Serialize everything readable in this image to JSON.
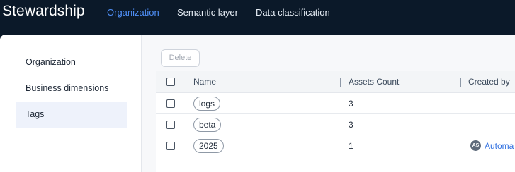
{
  "app": {
    "title": "Stewardship"
  },
  "nav": {
    "tabs": [
      {
        "label": "Organization",
        "active": true
      },
      {
        "label": "Semantic layer",
        "active": false
      },
      {
        "label": "Data classification",
        "active": false
      }
    ]
  },
  "sidebar": {
    "items": [
      {
        "label": "Organization",
        "active": false
      },
      {
        "label": "Business dimensions",
        "active": false
      },
      {
        "label": "Tags",
        "active": true
      }
    ]
  },
  "toolbar": {
    "delete_label": "Delete"
  },
  "table": {
    "columns": [
      "Name",
      "Assets Count",
      "Created by"
    ],
    "rows": [
      {
        "name": "logs",
        "assets_count": "3",
        "creator_initials": "",
        "created_by": ""
      },
      {
        "name": "beta",
        "assets_count": "3",
        "creator_initials": "",
        "created_by": ""
      },
      {
        "name": "2025",
        "assets_count": "1",
        "creator_initials": "AS",
        "created_by": "Automa"
      }
    ]
  },
  "colors": {
    "background": "#0b1929",
    "accent": "#4f8ff7",
    "link": "#2f6fe0",
    "sidebar_active": "#eef2fb"
  }
}
